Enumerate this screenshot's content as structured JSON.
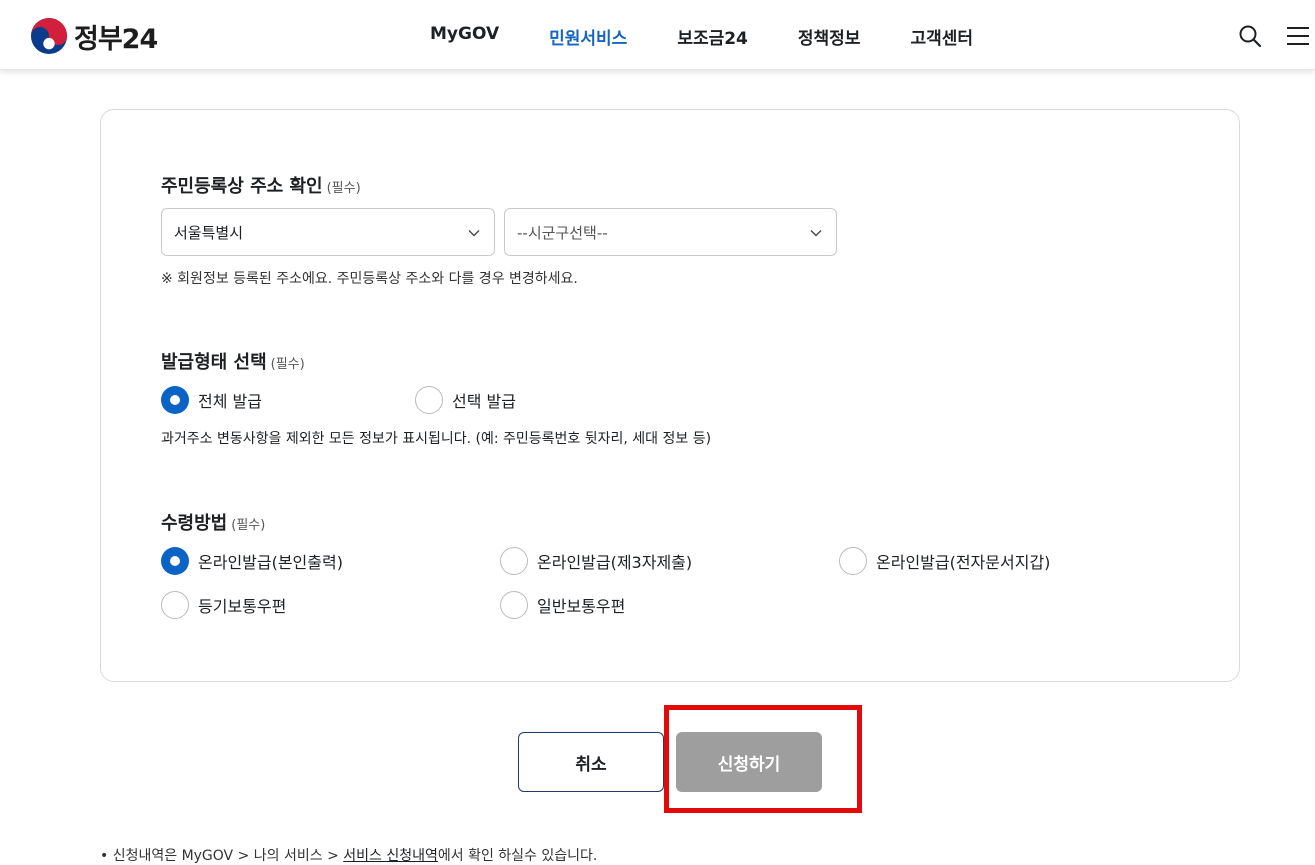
{
  "header": {
    "logo_text": "정부24",
    "nav": [
      "MyGOV",
      "민원서비스",
      "보조금24",
      "정책정보",
      "고객센터"
    ],
    "active_nav": "민원서비스",
    "accent_color": "#1565c0"
  },
  "form": {
    "address": {
      "title": "주민등록상 주소 확인",
      "required": "(필수)",
      "city_select": "서울특별시",
      "district_select": "--시군구선택--",
      "note": "※ 회원정보 등록된 주소에요. 주민등록상 주소와 다를 경우 변경하세요."
    },
    "issue_type": {
      "title": "발급형태 선택",
      "required": "(필수)",
      "options": [
        "전체 발급",
        "선택 발급"
      ],
      "selected": "전체 발급",
      "note": "과거주소 변동사항을 제외한 모든 정보가 표시됩니다. (예: 주민등록번호 뒷자리, 세대 정보 등)"
    },
    "receive_method": {
      "title": "수령방법",
      "required": "(필수)",
      "options": [
        "온라인발급(본인출력)",
        "온라인발급(제3자제출)",
        "온라인발급(전자문서지갑)",
        "등기보통우편",
        "일반보통우편"
      ],
      "selected": "온라인발급(본인출력)"
    }
  },
  "buttons": {
    "cancel": "취소",
    "submit": "신청하기"
  },
  "footer": {
    "bullet": "•",
    "prefix": "신청내역은 MyGOV > 나의 서비스 > ",
    "link": "서비스 신청내역",
    "suffix": "에서 확인 하실수 있습니다."
  },
  "colors": {
    "radio_checked": "#0b63c5",
    "submit_disabled": "#9e9e9e",
    "highlight": "#e50a0a"
  }
}
